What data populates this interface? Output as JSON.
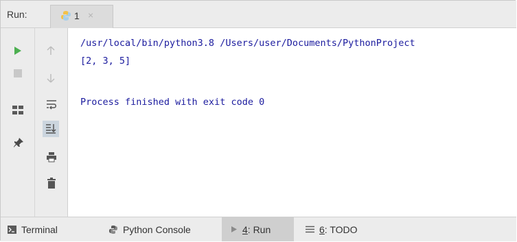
{
  "header": {
    "run_label": "Run:",
    "tab": {
      "label": "1",
      "close": "×",
      "icon": "python-icon"
    }
  },
  "left_toolbar": [
    {
      "name": "rerun-icon",
      "color": "#4caf50"
    },
    {
      "name": "stop-icon",
      "color": "#c8c8c8"
    },
    {
      "name": "layout-icon",
      "color": "#5a5a5a"
    },
    {
      "name": "pin-icon",
      "color": "#5a5a5a"
    }
  ],
  "right_toolbar": [
    {
      "name": "up-arrow-icon"
    },
    {
      "name": "down-arrow-icon"
    },
    {
      "name": "soft-wrap-icon"
    },
    {
      "name": "scroll-to-end-icon"
    },
    {
      "name": "print-icon"
    },
    {
      "name": "trash-icon"
    }
  ],
  "console": {
    "lines": [
      "/usr/local/bin/python3.8 /Users/user/Documents/PythonProject",
      "[2, 3, 5]",
      "",
      "Process finished with exit code 0"
    ],
    "text_color": "#1b1b9e"
  },
  "bottom_tabs": {
    "terminal": {
      "label": "Terminal",
      "icon": "terminal-icon"
    },
    "python_console": {
      "label": "Python Console",
      "icon": "python-console-icon"
    },
    "run": {
      "num": "4",
      "rest": ": Run",
      "icon": "run-play-icon",
      "active": true
    },
    "todo": {
      "num": "6",
      "rest": ": TODO",
      "icon": "todo-list-icon"
    }
  }
}
